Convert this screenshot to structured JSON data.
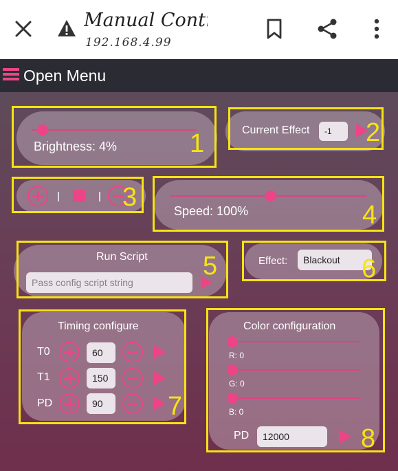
{
  "browser": {
    "title": "Manual Control",
    "url": "192.168.4.99",
    "icons": [
      "close-icon",
      "warning-icon",
      "bookmark-icon",
      "share-icon",
      "more-vert-icon"
    ]
  },
  "appbar": {
    "menu_label": "Open Menu",
    "menu_icon": "hamburger-icon"
  },
  "brightness": {
    "label": "Brightness: 4%",
    "value": 4,
    "marker": "1"
  },
  "current_effect": {
    "label": "Current Effect",
    "value": "-1",
    "marker": "2"
  },
  "power": {
    "marker": "3"
  },
  "speed": {
    "label": "Speed: 100%",
    "value": 100,
    "marker": "4"
  },
  "run_script": {
    "title": "Run Script",
    "placeholder": "Pass config script string",
    "marker": "5"
  },
  "effect": {
    "label": "Effect:",
    "value": "Blackout",
    "marker": "6"
  },
  "timing": {
    "title": "Timing configure",
    "marker": "7",
    "rows": [
      {
        "label": "T0",
        "value": "60"
      },
      {
        "label": "T1",
        "value": "150"
      },
      {
        "label": "PD",
        "value": "90"
      }
    ]
  },
  "color": {
    "title": "Color configuration",
    "marker": "8",
    "channels": [
      {
        "label": "R: 0",
        "value": 0
      },
      {
        "label": "G: 0",
        "value": 0
      },
      {
        "label": "B: 0",
        "value": 0
      }
    ],
    "pd_label": "PD",
    "pd_value": "12000"
  },
  "colors": {
    "accent": "#ec4585",
    "highlight": "#f7e313",
    "appbar": "#2b2c33"
  }
}
